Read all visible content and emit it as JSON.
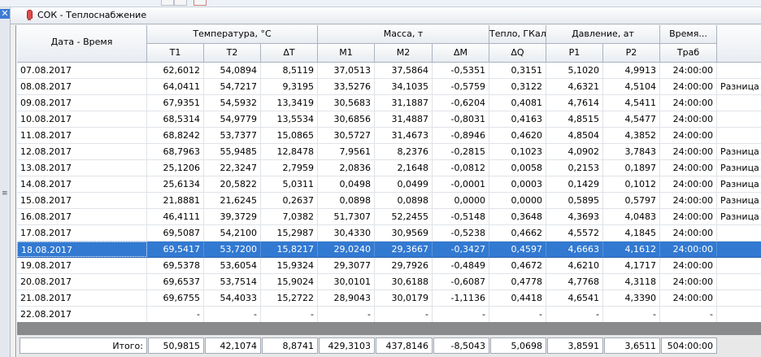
{
  "window": {
    "title": "СОК - Теплоснабжение",
    "close_glyph": "✕"
  },
  "header": {
    "date_time": "Дата - Время",
    "groups": {
      "temperature": "Температура, °С",
      "mass": "Масса, т",
      "heat": "Тепло, ГКал",
      "pressure": "Давление, ат",
      "time": "Время..."
    },
    "cols": {
      "t1": "T1",
      "t2": "T2",
      "dt": "ΔT",
      "m1": "M1",
      "m2": "M2",
      "dm": "ΔM",
      "dq": "ΔQ",
      "p1": "P1",
      "p2": "P2",
      "traб": "Траб"
    }
  },
  "rows": [
    {
      "date": "07.08.2017",
      "t1": "62,6012",
      "t2": "54,0894",
      "dt": "8,5119",
      "m1": "37,0513",
      "m2": "37,5864",
      "dm": "-0,5351",
      "dq": "0,3151",
      "p1": "5,1020",
      "p2": "4,9913",
      "tr": "24:00:00",
      "note": ""
    },
    {
      "date": "08.08.2017",
      "t1": "64,0411",
      "t2": "54,7217",
      "dt": "9,3195",
      "m1": "33,5276",
      "m2": "34,1035",
      "dm": "-0,5759",
      "dq": "0,3122",
      "p1": "4,6321",
      "p2": "4,5104",
      "tr": "24:00:00",
      "note": "Разница те"
    },
    {
      "date": "09.08.2017",
      "t1": "67,9351",
      "t2": "54,5932",
      "dt": "13,3419",
      "m1": "30,5683",
      "m2": "31,1887",
      "dm": "-0,6204",
      "dq": "0,4081",
      "p1": "4,7614",
      "p2": "4,5411",
      "tr": "24:00:00",
      "note": ""
    },
    {
      "date": "10.08.2017",
      "t1": "68,5314",
      "t2": "54,9779",
      "dt": "13,5534",
      "m1": "30,6856",
      "m2": "31,4887",
      "dm": "-0,8031",
      "dq": "0,4163",
      "p1": "4,8515",
      "p2": "4,5477",
      "tr": "24:00:00",
      "note": ""
    },
    {
      "date": "11.08.2017",
      "t1": "68,8242",
      "t2": "53,7377",
      "dt": "15,0865",
      "m1": "30,5727",
      "m2": "31,4673",
      "dm": "-0,8946",
      "dq": "0,4620",
      "p1": "4,8504",
      "p2": "4,3852",
      "tr": "24:00:00",
      "note": ""
    },
    {
      "date": "12.08.2017",
      "t1": "68,7963",
      "t2": "55,9485",
      "dt": "12,8478",
      "m1": "7,9561",
      "m2": "8,2376",
      "dm": "-0,2815",
      "dq": "0,1023",
      "p1": "4,0902",
      "p2": "3,7843",
      "tr": "24:00:00",
      "note": "Разница те"
    },
    {
      "date": "13.08.2017",
      "t1": "25,1206",
      "t2": "22,3247",
      "dt": "2,7959",
      "m1": "2,0836",
      "m2": "2,1648",
      "dm": "-0,0812",
      "dq": "0,0058",
      "p1": "0,2153",
      "p2": "0,1897",
      "tr": "24:00:00",
      "note": "Разница те"
    },
    {
      "date": "14.08.2017",
      "t1": "25,6134",
      "t2": "20,5822",
      "dt": "5,0311",
      "m1": "0,0498",
      "m2": "0,0499",
      "dm": "-0,0001",
      "dq": "0,0003",
      "p1": "0,1429",
      "p2": "0,1012",
      "tr": "24:00:00",
      "note": "Разница те"
    },
    {
      "date": "15.08.2017",
      "t1": "21,8881",
      "t2": "21,6245",
      "dt": "0,2637",
      "m1": "0,0898",
      "m2": "0,0898",
      "dm": "0,0000",
      "dq": "0,0000",
      "p1": "0,5895",
      "p2": "0,5797",
      "tr": "24:00:00",
      "note": "Разница те"
    },
    {
      "date": "16.08.2017",
      "t1": "46,4111",
      "t2": "39,3729",
      "dt": "7,0382",
      "m1": "51,7307",
      "m2": "52,2455",
      "dm": "-0,5148",
      "dq": "0,3648",
      "p1": "4,3693",
      "p2": "4,0483",
      "tr": "24:00:00",
      "note": "Разница те"
    },
    {
      "date": "17.08.2017",
      "t1": "69,5087",
      "t2": "54,2100",
      "dt": "15,2987",
      "m1": "30,4330",
      "m2": "30,9569",
      "dm": "-0,5238",
      "dq": "0,4662",
      "p1": "4,5572",
      "p2": "4,1845",
      "tr": "24:00:00",
      "note": ""
    },
    {
      "date": "18.08.2017",
      "t1": "69,5417",
      "t2": "53,7200",
      "dt": "15,8217",
      "m1": "29,0240",
      "m2": "29,3667",
      "dm": "-0,3427",
      "dq": "0,4597",
      "p1": "4,6663",
      "p2": "4,1612",
      "tr": "24:00:00",
      "note": ""
    },
    {
      "date": "19.08.2017",
      "t1": "69,5378",
      "t2": "53,6054",
      "dt": "15,9324",
      "m1": "29,3077",
      "m2": "29,7926",
      "dm": "-0,4849",
      "dq": "0,4672",
      "p1": "4,6210",
      "p2": "4,1717",
      "tr": "24:00:00",
      "note": ""
    },
    {
      "date": "20.08.2017",
      "t1": "69,6537",
      "t2": "53,7514",
      "dt": "15,9024",
      "m1": "30,0101",
      "m2": "30,6188",
      "dm": "-0,6087",
      "dq": "0,4778",
      "p1": "4,7768",
      "p2": "4,3118",
      "tr": "24:00:00",
      "note": ""
    },
    {
      "date": "21.08.2017",
      "t1": "69,6755",
      "t2": "54,4033",
      "dt": "15,2722",
      "m1": "28,9043",
      "m2": "30,0179",
      "dm": "-1,1136",
      "dq": "0,4418",
      "p1": "4,6541",
      "p2": "4,3390",
      "tr": "24:00:00",
      "note": ""
    },
    {
      "date": "22.08.2017",
      "t1": "-",
      "t2": "-",
      "dt": "-",
      "m1": "-",
      "m2": "-",
      "dm": "-",
      "dq": "-",
      "p1": "-",
      "p2": "-",
      "tr": "-",
      "note": ""
    }
  ],
  "selected_row_index": 11,
  "totals": {
    "label": "Итого:",
    "t1": "50,9815",
    "t2": "42,1074",
    "dt": "8,8741",
    "m1": "429,3103",
    "m2": "437,8146",
    "dm": "-8,5043",
    "dq": "5,0698",
    "p1": "3,8591",
    "p2": "3,6511",
    "tr": "504:00:00"
  }
}
